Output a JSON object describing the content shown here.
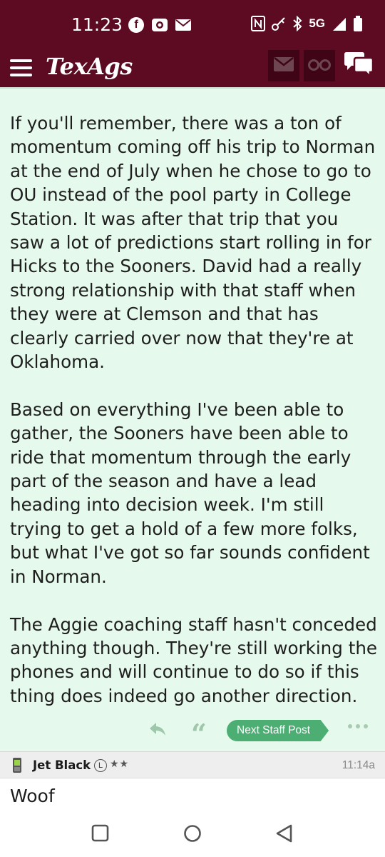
{
  "status_bar": {
    "time": "11:23",
    "network": "5G",
    "icons_left": [
      "facebook-icon",
      "camera-icon",
      "mail-icon"
    ],
    "icons_right": [
      "nfc-icon",
      "key-icon",
      "bluetooth-icon",
      "network-5g",
      "signal-icon",
      "battery-icon"
    ]
  },
  "app_bar": {
    "logo": "TexAgs",
    "icons": [
      "menu-icon",
      "mail-icon",
      "binoculars-icon",
      "chat-icon"
    ],
    "brand_color": "#5c0b22"
  },
  "post": {
    "background": "#e5f9ec",
    "paragraphs": [
      "If you'll remember, there was a ton of momentum coming off his trip to Norman at the end of July when he chose to go to OU instead of the pool party in College Station. It was after that trip that you saw a lot of predictions start rolling in for Hicks to the Sooners. David had a really strong relationship with that staff when they were at Clemson and that has clearly carried over now that they're at Oklahoma.",
      "Based on everything I've been able to gather, the Sooners have been able to ride that momentum through the early part of the season and have a lead heading into decision week. I'm still trying to get a hold of a few more folks, but what I've got so far sounds confident in Norman.",
      "The Aggie coaching staff hasn't conceded anything though. They're still working the phones and will continue to do so if this thing does indeed go another direction."
    ],
    "actions": {
      "quote_glyph": "“",
      "next_staff_label": "Next Staff Post",
      "accent": "#4dae74"
    }
  },
  "reply": {
    "username": "Jet Black",
    "level": "L",
    "stars": "★★",
    "time": "11:14a",
    "body": "Woof"
  }
}
